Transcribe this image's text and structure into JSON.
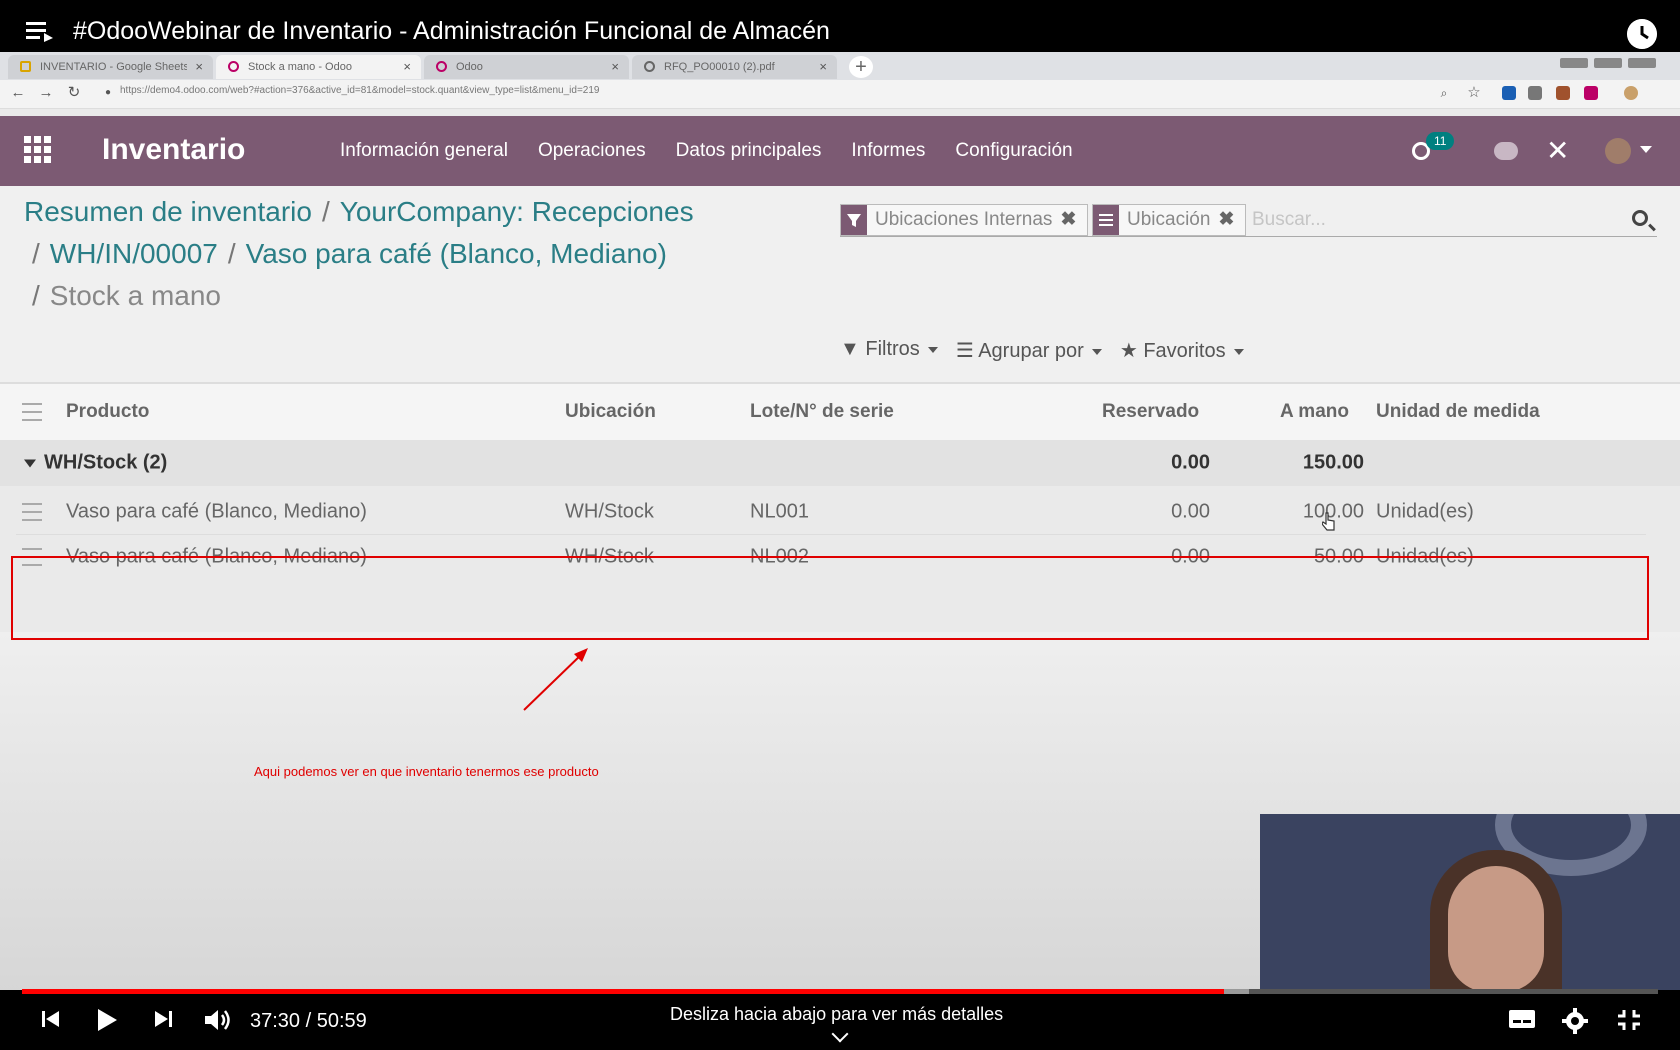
{
  "video": {
    "title": "#OdooWebinar de Inventario - Administración Funcional de Almacén",
    "time_current": "37:30",
    "time_separator": " / ",
    "time_total": "50:59",
    "progress_fraction": 0.735,
    "buffered_fraction": 0.75,
    "scroll_hint": "Desliza hacia abajo para ver más detalles",
    "annotation": "Aqui podemos ver en que inventario tenermos ese producto"
  },
  "browser": {
    "tabs": [
      {
        "label": "INVENTARIO - Google Sheets",
        "icon": "sheets-icon",
        "active": false
      },
      {
        "label": "Stock a mano - Odoo",
        "icon": "odoo-icon",
        "active": true
      },
      {
        "label": "Odoo",
        "icon": "odoo-icon",
        "active": false
      },
      {
        "label": "RFQ_PO00010 (2).pdf",
        "icon": "globe-icon",
        "active": false
      }
    ],
    "url": "https://demo4.odoo.com/web?#action=376&active_id=81&model=stock.quant&view_type=list&menu_id=219"
  },
  "odoo": {
    "app_name": "Inventario",
    "menu": [
      "Información general",
      "Operaciones",
      "Datos principales",
      "Informes",
      "Configuración"
    ],
    "activity_count": "11",
    "accent_color": "#7c5a73",
    "link_color": "#2a7e86"
  },
  "breadcrumb": {
    "items": [
      "Resumen de inventario",
      "YourCompany: Recepciones",
      "WH/IN/00007",
      "Vaso para café (Blanco, Mediano)"
    ],
    "current": "Stock a mano",
    "separator": "/"
  },
  "search": {
    "facets": [
      "Ubicaciones Internas",
      "Ubicación"
    ],
    "placeholder": "Buscar..."
  },
  "filters": {
    "filtros": "Filtros",
    "agrupar": "Agrupar por",
    "favoritos": "Favoritos"
  },
  "table": {
    "headers": {
      "producto": "Producto",
      "ubicacion": "Ubicación",
      "lote": "Lote/N° de serie",
      "reservado": "Reservado",
      "a_mano": "A mano",
      "unidad": "Unidad de medida"
    },
    "group": {
      "label": "WH/Stock (2)",
      "reservado": "0.00",
      "a_mano": "150.00"
    },
    "rows": [
      {
        "producto": "Vaso para café (Blanco, Mediano)",
        "ubicacion": "WH/Stock",
        "lote": "NL001",
        "reservado": "0.00",
        "a_mano": "100.00",
        "unidad": "Unidad(es)"
      },
      {
        "producto": "Vaso para café (Blanco, Mediano)",
        "ubicacion": "WH/Stock",
        "lote": "NL002",
        "reservado": "0.00",
        "a_mano": "50.00",
        "unidad": "Unidad(es)"
      }
    ]
  }
}
